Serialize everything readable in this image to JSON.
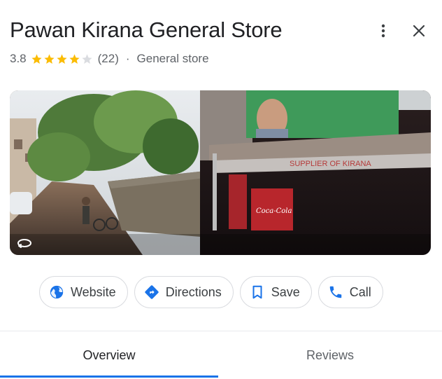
{
  "place": {
    "name": "Pawan Kirana General Store",
    "rating": "3.8",
    "stars_filled": 4,
    "stars_total": 5,
    "review_count": "(22)",
    "separator": "·",
    "category": "General store"
  },
  "header": {
    "more_icon": "more-vert-icon",
    "close_icon": "close-icon"
  },
  "photo": {
    "overlay_icon": "360-panorama-icon"
  },
  "actions": [
    {
      "label": "Website",
      "icon": "globe-icon"
    },
    {
      "label": "Directions",
      "icon": "directions-icon"
    },
    {
      "label": "Save",
      "icon": "bookmark-icon"
    },
    {
      "label": "Call",
      "icon": "phone-icon"
    }
  ],
  "tabs": {
    "overview": "Overview",
    "reviews": "Reviews",
    "active": "overview"
  },
  "colors": {
    "accent": "#1a73e8",
    "star": "#fbbc04",
    "star_empty": "#dadce0",
    "text": "#202124",
    "secondary": "#5f6368"
  }
}
